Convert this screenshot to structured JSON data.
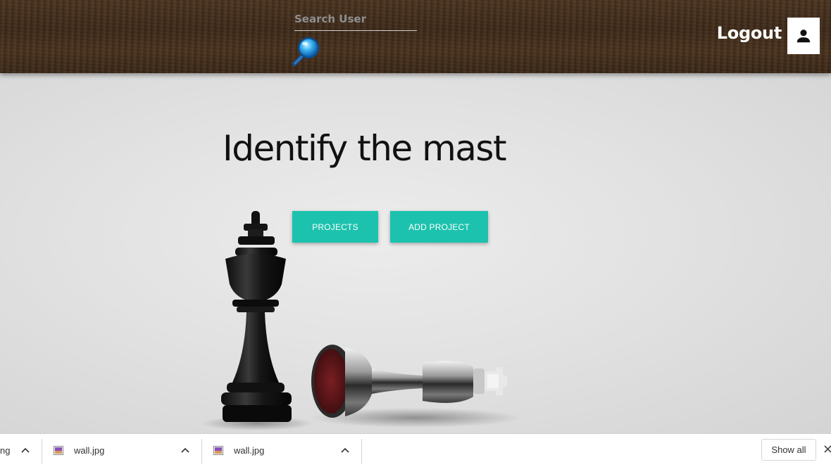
{
  "header": {
    "search_placeholder": "Search User",
    "search_value": "",
    "search_icon": "magnifier-icon",
    "logout_label": "Logout",
    "avatar_icon": "person-icon"
  },
  "hero": {
    "title": "Identify the mast",
    "projects_label": "PROJECTS",
    "add_project_label": "ADD PROJECT",
    "button_color": "#1cc2ae"
  },
  "downloads": {
    "items": [
      {
        "name": "ng"
      },
      {
        "name": "wall.jpg"
      },
      {
        "name": "wall.jpg"
      }
    ],
    "show_all_label": "Show all"
  }
}
